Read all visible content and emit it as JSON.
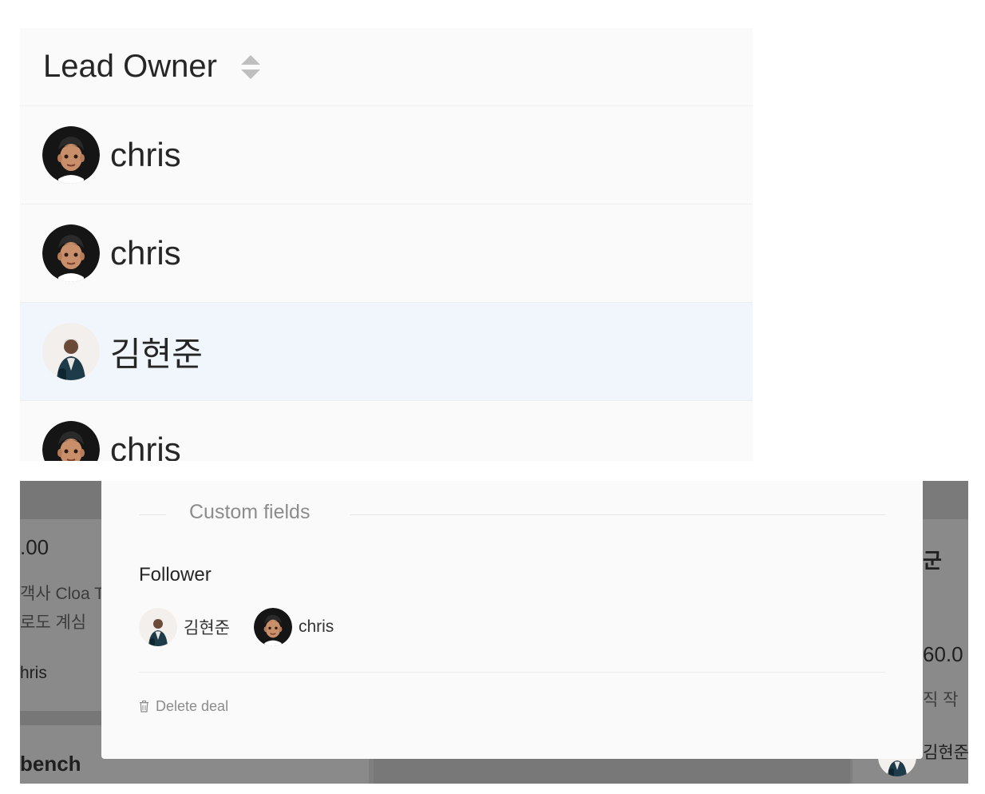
{
  "lead_table": {
    "header": "Lead Owner",
    "rows": [
      {
        "name": "chris",
        "avatar": "memoji-avatar",
        "highlighted": false
      },
      {
        "name": "chris",
        "avatar": "memoji-avatar",
        "highlighted": false
      },
      {
        "name": "김현준",
        "avatar": "photo-avatar",
        "highlighted": true
      },
      {
        "name": "chris",
        "avatar": "memoji-avatar",
        "highlighted": false
      }
    ]
  },
  "background_board": {
    "left_amount": ".00",
    "left_line1": "객사 Cloa T",
    "left_line2": "로도 계심",
    "left_owner": "hris",
    "left_bottom_title": "bench",
    "right_title": "군",
    "right_amount": "60.0",
    "right_line": "직 작",
    "right_owner": "김현준"
  },
  "drawer": {
    "section_title": "Custom fields",
    "follower_label": "Follower",
    "followers": [
      {
        "name": "김현준",
        "avatar": "photo-avatar"
      },
      {
        "name": "chris",
        "avatar": "memoji-avatar"
      }
    ],
    "delete_label": "Delete deal",
    "delete_icon": "trash-icon"
  },
  "colors": {
    "highlight_row": "#f0f6fb",
    "table_bg": "#fafafa",
    "overlay": "#7f7f7f",
    "muted_text": "#8c8c8c"
  }
}
